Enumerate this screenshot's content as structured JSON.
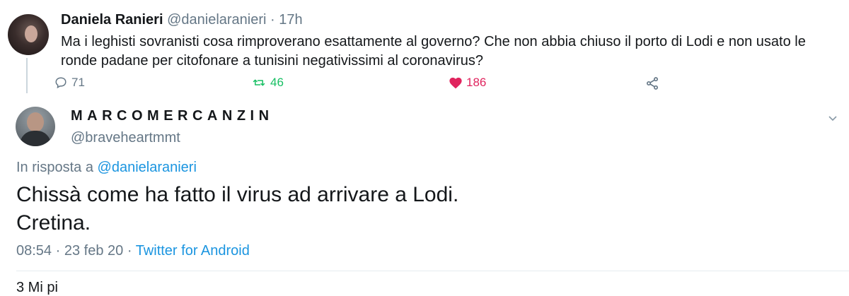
{
  "quoted_tweet": {
    "author_name": "Daniela Ranieri",
    "author_handle": "@danielaranieri",
    "time_sep": " · ",
    "time": "17h",
    "text": "Ma i leghisti sovranisti cosa rimproverano esattamente al governo? Che non abbia chiuso il porto di Lodi e non usato le ronde padane per citofonare a tunisini negativissimi al coronavirus?",
    "replies": "71",
    "retweets": "46",
    "likes": "186",
    "icons": {
      "reply": "reply-icon",
      "retweet": "retweet-icon",
      "like": "heart-icon",
      "share": "share-icon"
    }
  },
  "main_tweet": {
    "author_name": "MARCOMERCANZIN",
    "author_handle": "@braveheartmmt",
    "reply_prefix": "In risposta a ",
    "reply_to": "@danielaranieri",
    "text_line1": "Chissà come ha fatto il virus ad arrivare a Lodi.",
    "text_line2": "Cretina.",
    "time": "08:54",
    "date": "23 feb 20",
    "source": "Twitter for Android",
    "sep": " · "
  },
  "footer_cut_text": "3 Mi pi",
  "colors": {
    "link": "#1b95e0",
    "retweet": "#17bf63",
    "like": "#e0245e",
    "muted": "#657786"
  }
}
